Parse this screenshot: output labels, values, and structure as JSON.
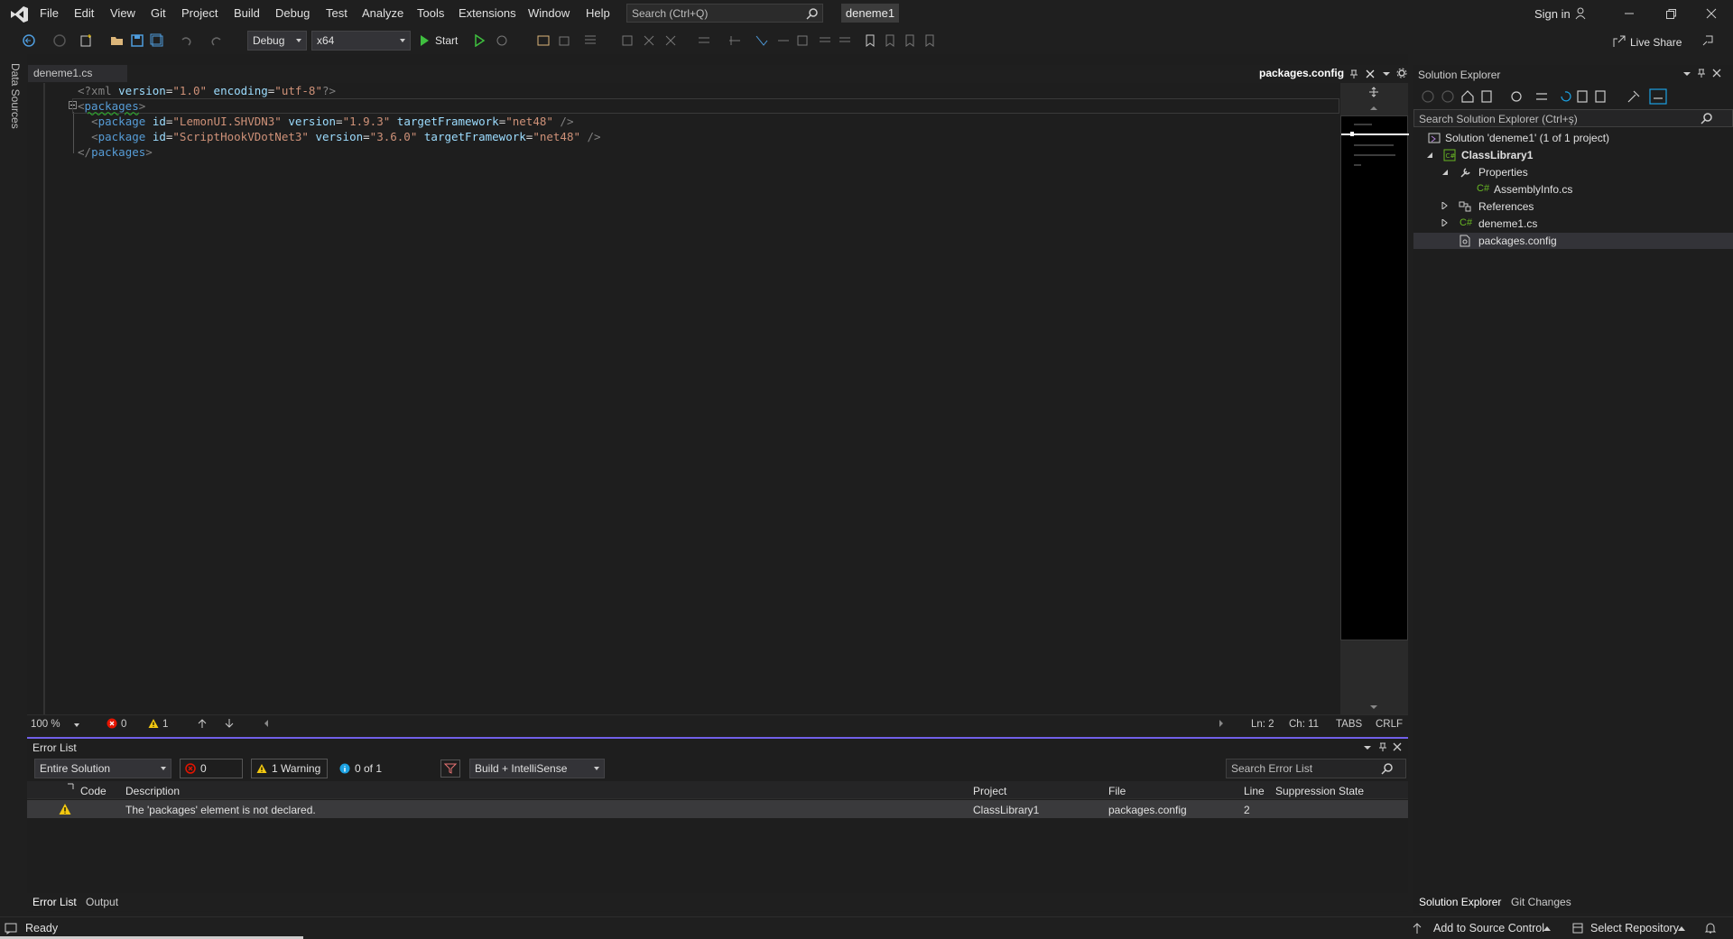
{
  "menu": [
    "File",
    "Edit",
    "View",
    "Git",
    "Project",
    "Build",
    "Debug",
    "Test",
    "Analyze",
    "Tools",
    "Extensions",
    "Window",
    "Help"
  ],
  "search": {
    "placeholder": "Search (Ctrl+Q)"
  },
  "project_name": "deneme1",
  "account": {
    "sign_in": "Sign in"
  },
  "live_share": "Live Share",
  "toolbar": {
    "config": "Debug",
    "platform": "x64",
    "start": "Start"
  },
  "left_strip": {
    "data_sources": "Data Sources"
  },
  "editor": {
    "tabs": [
      {
        "label": "deneme1.cs"
      },
      {
        "label": "packages.config"
      }
    ],
    "status": {
      "zoom": "100 %",
      "errors": "0",
      "warnings": "1",
      "line": "Ln: 2",
      "col": "Ch: 11",
      "indent": "TABS",
      "eol": "CRLF"
    }
  },
  "code": {
    "l1": {
      "decl_open": "<?xml ",
      "a1": "version",
      "v1": "\"1.0\"",
      "a2": "encoding",
      "v2": "\"utf-8\"",
      "decl_close": "?>"
    },
    "l2": {
      "open": "<",
      "tag": "packages",
      "close": ">"
    },
    "pkg1": {
      "tag": "package",
      "a1": "id",
      "v1": "\"LemonUI.SHVDN3\"",
      "a2": "version",
      "v2": "\"1.9.3\"",
      "a3": "targetFramework",
      "v3": "\"net48\"",
      "end": " />"
    },
    "pkg2": {
      "tag": "package",
      "a1": "id",
      "v1": "\"ScriptHookVDotNet3\"",
      "a2": "version",
      "v2": "\"3.6.0\"",
      "a3": "targetFramework",
      "v3": "\"net48\"",
      "end": " />"
    },
    "l5": {
      "open": "</",
      "tag": "packages",
      "close": ">"
    }
  },
  "error_list": {
    "title": "Error List",
    "scope": "Entire Solution",
    "errors_btn": "0 Errors",
    "warnings_btn": "1 Warning",
    "messages_btn": "0 of 1 Message",
    "build_filter": "Build + IntelliSense",
    "search_placeholder": "Search Error List",
    "columns": {
      "code": "Code",
      "description": "Description",
      "project": "Project",
      "file": "File",
      "line": "Line",
      "suppression": "Suppression State"
    },
    "rows": [
      {
        "description": "The 'packages' element is not declared.",
        "project": "ClassLibrary1",
        "file": "packages.config",
        "line": "2"
      }
    ]
  },
  "bottom_tabs": [
    "Error List",
    "Output"
  ],
  "solution_explorer": {
    "title": "Solution Explorer",
    "search_placeholder": "Search Solution Explorer (Ctrl+ş)",
    "solution": "Solution 'deneme1' (1 of 1 project)",
    "project": "ClassLibrary1",
    "properties": "Properties",
    "assemblyinfo": "AssemblyInfo.cs",
    "references": "References",
    "deneme1cs": "deneme1.cs",
    "packagesconfig": "packages.config",
    "tab_solution": "Solution Explorer",
    "tab_git": "Git Changes"
  },
  "statusbar": {
    "ready": "Ready",
    "source_control": "Add to Source Control",
    "repository": "Select Repository"
  },
  "colors": {
    "accent": "#7160e8",
    "warning": "#f2c811",
    "error": "#e51400",
    "play": "#3fbf3f"
  }
}
